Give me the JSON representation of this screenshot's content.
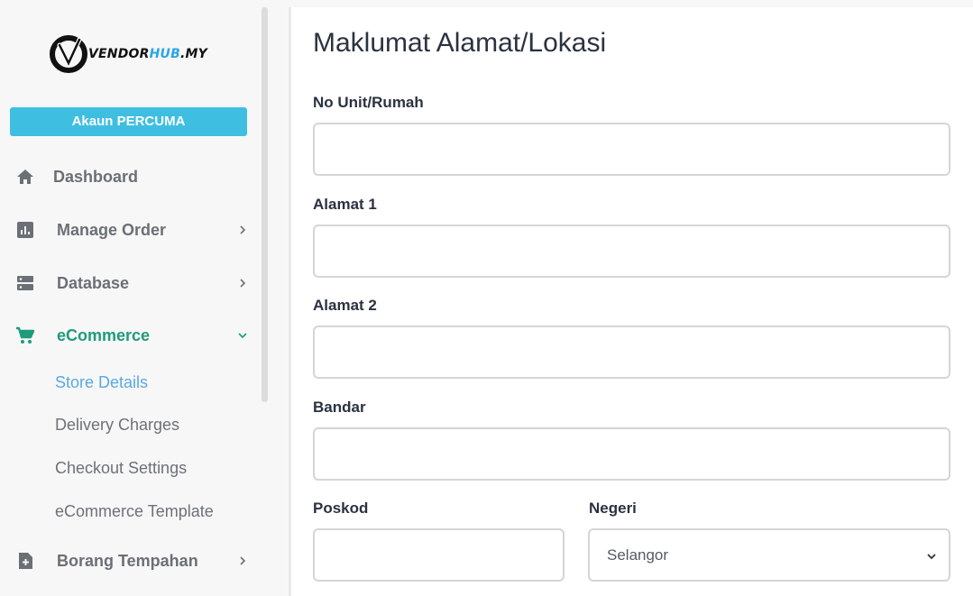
{
  "brand": {
    "name_part1": "VENDOR",
    "name_part2": "HUB",
    "name_part3": ".MY"
  },
  "account_button": "Akaun PERCUMA",
  "nav": [
    {
      "label": "Dashboard",
      "icon": "home-icon"
    },
    {
      "label": "Manage Order",
      "icon": "bar-chart-icon"
    },
    {
      "label": "Database",
      "icon": "server-icon"
    },
    {
      "label": "eCommerce",
      "icon": "shopping-cart-icon"
    },
    {
      "label": "Borang Tempahan",
      "icon": "file-plus-icon"
    }
  ],
  "ecommerce_sub": [
    "Store Details",
    "Delivery Charges",
    "Checkout Settings",
    "eCommerce Template"
  ],
  "colors": {
    "accent": "#3ebfe2",
    "active_nav": "#1e9b7d",
    "active_sub": "#5aa9e0"
  },
  "form": {
    "title": "Maklumat Alamat/Lokasi",
    "no_unit_label": "No Unit/Rumah",
    "alamat1_label": "Alamat 1",
    "alamat2_label": "Alamat 2",
    "bandar_label": "Bandar",
    "poskod_label": "Poskod",
    "negeri_label": "Negeri",
    "negeri_value": "Selangor"
  }
}
